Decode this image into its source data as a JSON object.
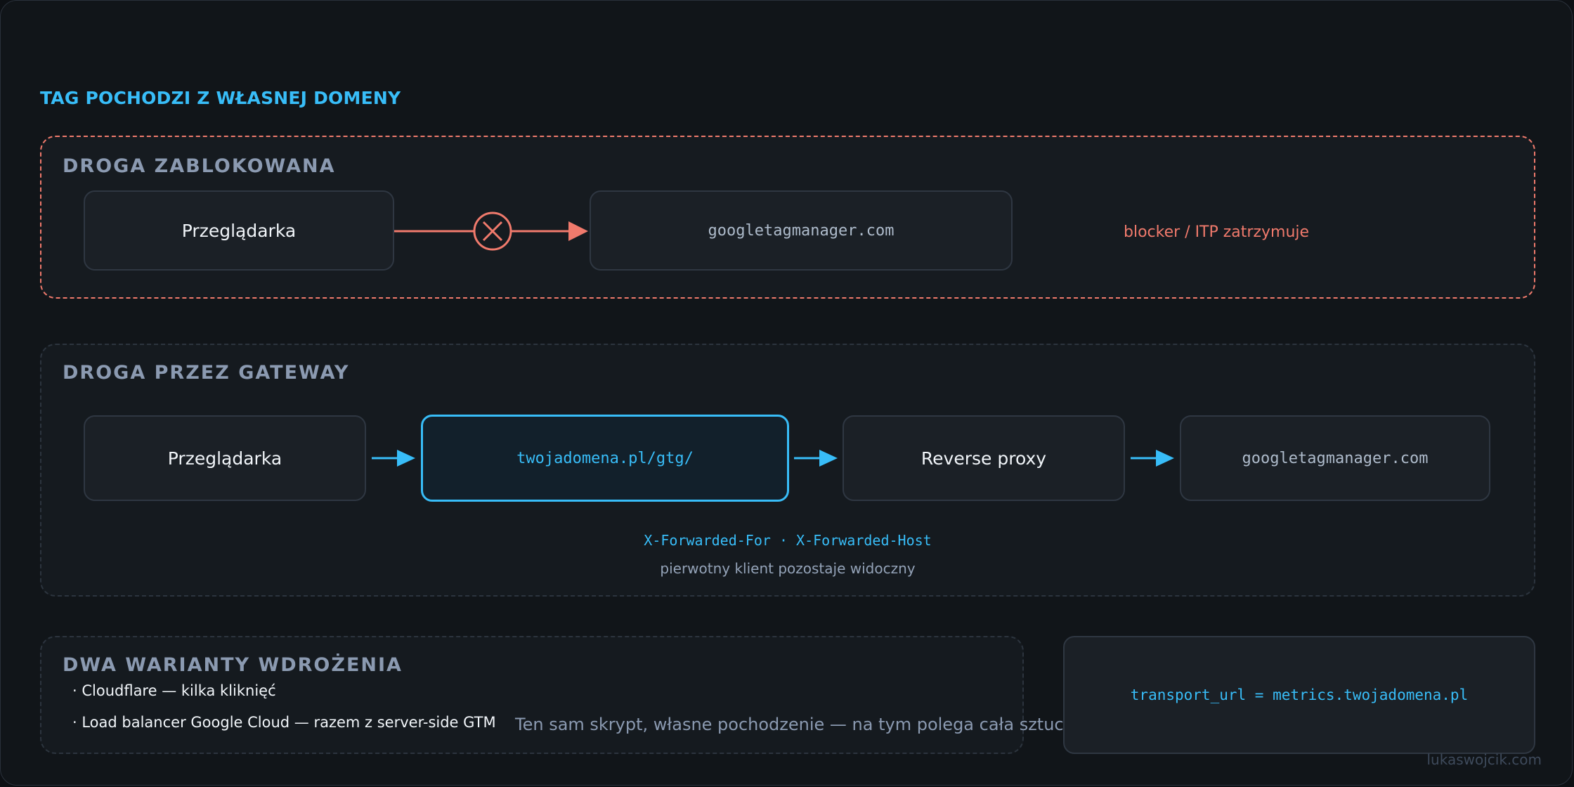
{
  "headline": "TAG POCHODZI Z WŁASNEJ DOMENY",
  "blocked": {
    "title": "DROGA ZABLOKOWANA",
    "browser": "Przeglądarka",
    "target": "googletagmanager.com",
    "note": "blocker / ITP zatrzymuje"
  },
  "gateway": {
    "title": "DROGA PRZEZ GATEWAY",
    "browser": "Przeglądarka",
    "own_domain": "twojadomena.pl/gtg/",
    "proxy": "Reverse proxy",
    "target": "googletagmanager.com",
    "headers": "X-Forwarded-For · X-Forwarded-Host",
    "headers_note": "pierwotny klient pozostaje widoczny"
  },
  "variants": {
    "title": "DWA WARIANTY WDROŻENIA",
    "items": [
      "· Cloudflare — kilka kliknięć",
      "· Load balancer Google Cloud — razem z server-side GTM"
    ]
  },
  "transport": "transport_url = metrics.twojadomena.pl",
  "tagline": "Ten sam skrypt, własne pochodzenie — na tym polega cała sztuczka",
  "footer": "lukaswojcik.com",
  "colors": {
    "accent": "#38bdf8",
    "blocked": "#f07a6c",
    "muted": "#8b9ab1"
  }
}
